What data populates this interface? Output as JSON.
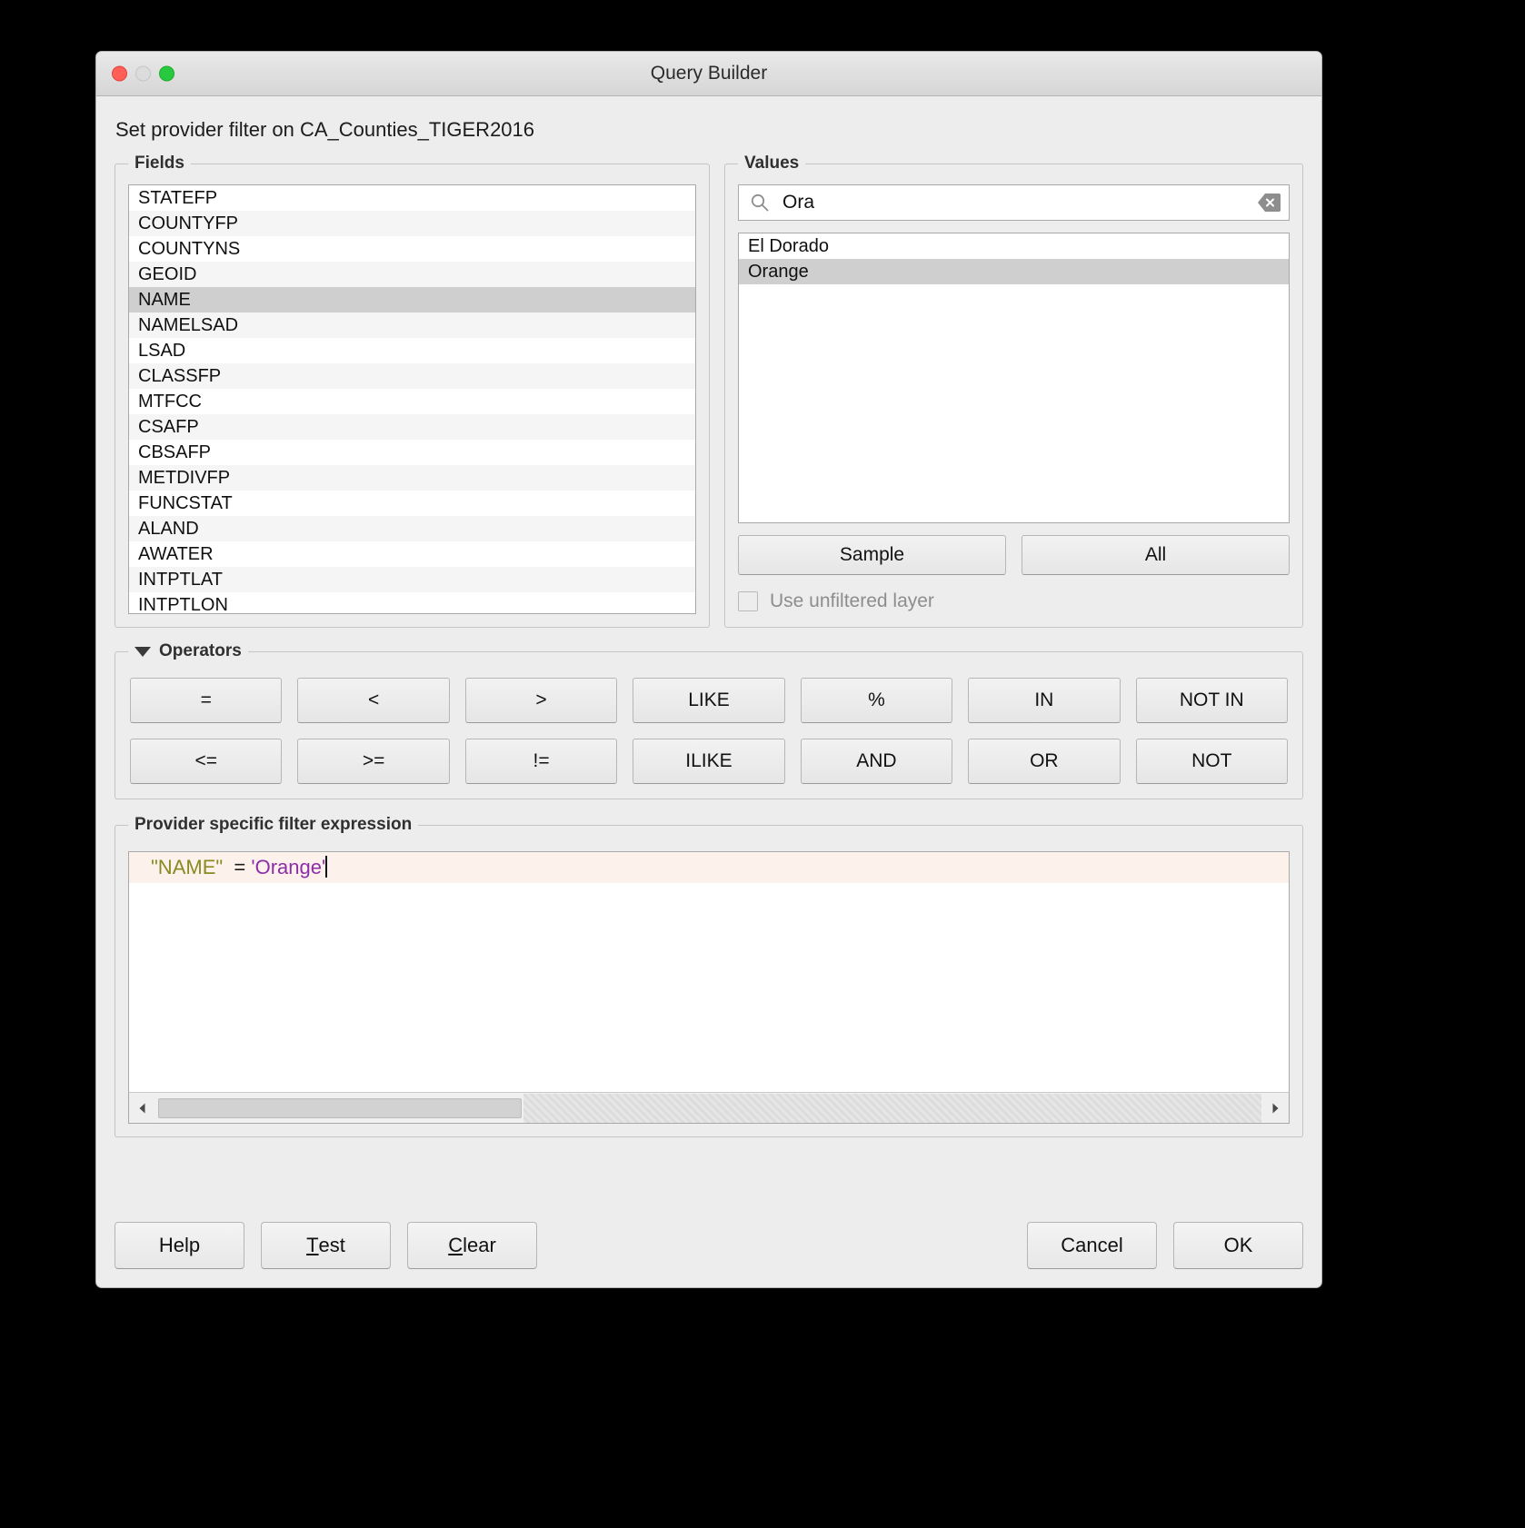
{
  "window": {
    "title": "Query Builder",
    "subtitle": "Set provider filter on CA_Counties_TIGER2016"
  },
  "fields": {
    "legend": "Fields",
    "items": [
      "STATEFP",
      "COUNTYFP",
      "COUNTYNS",
      "GEOID",
      "NAME",
      "NAMELSAD",
      "LSAD",
      "CLASSFP",
      "MTFCC",
      "CSAFP",
      "CBSAFP",
      "METDIVFP",
      "FUNCSTAT",
      "ALAND",
      "AWATER",
      "INTPTLAT",
      "INTPTLON"
    ],
    "selected": "NAME"
  },
  "values": {
    "legend": "Values",
    "search": {
      "value": "Ora",
      "placeholder": "Search",
      "icon": "search-icon",
      "clear_icon": "clear-icon"
    },
    "items": [
      "El Dorado",
      "Orange"
    ],
    "selected": "Orange",
    "sample_label": "Sample",
    "all_label": "All",
    "unfiltered_label": "Use unfiltered layer",
    "unfiltered_checked": false,
    "unfiltered_enabled": false
  },
  "operators": {
    "legend": "Operators",
    "collapse_icon": "triangle-down-icon",
    "row1": [
      "=",
      "<",
      ">",
      "LIKE",
      "%",
      "IN",
      "NOT IN"
    ],
    "row2": [
      "<=",
      ">=",
      "!=",
      "ILIKE",
      "AND",
      "OR",
      "NOT"
    ]
  },
  "expression": {
    "legend": "Provider specific filter expression",
    "tokens": {
      "field": "\"NAME\"",
      "operator": "  = ",
      "string": "'Orange'"
    },
    "full_text": "\"NAME\"  = 'Orange'",
    "scroll_left_icon": "chevron-left-icon",
    "scroll_right_icon": "chevron-right-icon"
  },
  "footer": {
    "help": "Help",
    "test_prefix": "T",
    "test_rest": "est",
    "clear_prefix": "C",
    "clear_rest": "lear",
    "cancel": "Cancel",
    "ok": "OK"
  },
  "colors": {
    "field_token": "#8a8a22",
    "string_token": "#8d2ea8",
    "selection": "#cfcfcf",
    "current_line": "#fdf1ec"
  }
}
